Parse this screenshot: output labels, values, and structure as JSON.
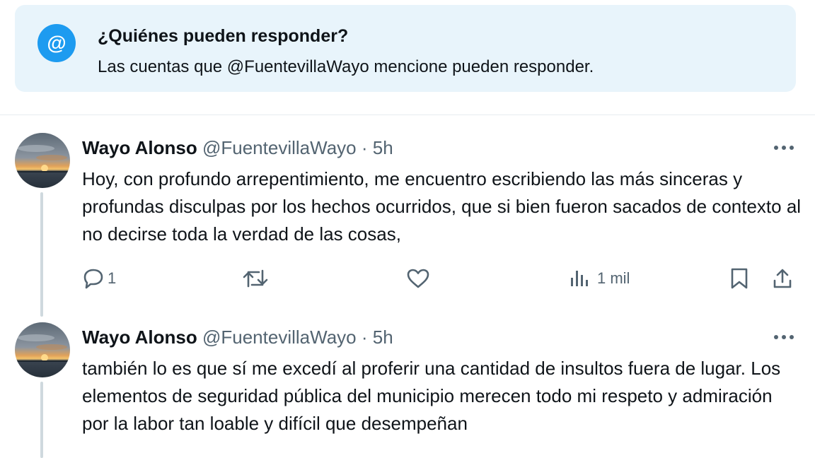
{
  "banner": {
    "icon": "at-sign-icon",
    "icon_glyph": "@",
    "title": "¿Quiénes pueden responder?",
    "text": "Las cuentas que @FuentevillaWayo mencione pueden responder."
  },
  "tweets": [
    {
      "author_name": "Wayo Alonso",
      "author_handle": "@FuentevillaWayo",
      "separator": "·",
      "time": "5h",
      "text": "Hoy, con profundo arrepentimiento, me encuentro escribiendo las más sinceras y profundas disculpas por los hechos ocurridos, que si bien fueron sacados de contexto al no decirse toda la verdad de las cosas,",
      "replies": "1",
      "views": "1 mil"
    },
    {
      "author_name": "Wayo Alonso",
      "author_handle": "@FuentevillaWayo",
      "separator": "·",
      "time": "5h",
      "text": "también lo es que sí me excedí al proferir una cantidad de insultos fuera de lugar. Los elementos de seguridad pública del municipio merecen todo mi respeto y admiración por la labor tan loable y difícil que desempeñan"
    }
  ],
  "colors": {
    "accent": "#1d9bf0",
    "banner_bg": "#e8f4fb",
    "secondary_text": "#536471",
    "thread_line": "#cfd9de"
  }
}
